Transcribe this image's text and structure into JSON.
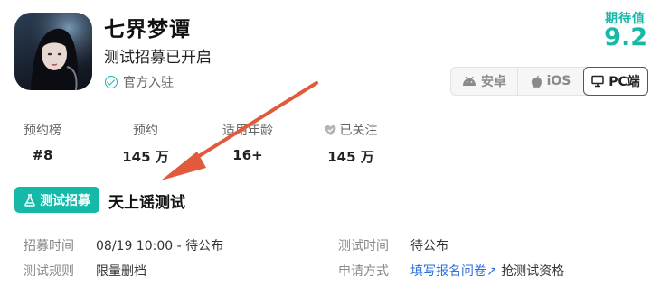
{
  "game": {
    "title": "七界梦谭",
    "subtitle": "测试招募已开启",
    "official_label": "官方入驻"
  },
  "rating": {
    "label": "期待值",
    "value": "9.2"
  },
  "platforms": {
    "android": "安卓",
    "ios": "iOS",
    "pc": "PC端",
    "selected": "PC端"
  },
  "stats": [
    {
      "label": "预约榜",
      "value": "#8"
    },
    {
      "label": "预约",
      "value": "145 万"
    },
    {
      "label": "适用年龄",
      "value": "16+"
    },
    {
      "label": "已关注",
      "value": "145 万"
    }
  ],
  "test": {
    "badge": "测试招募",
    "name": "天上谣测试",
    "recruit_time_label": "招募时间",
    "recruit_time_value": "08/19 10:00 - 待公布",
    "test_time_label": "测试时间",
    "test_time_value": "待公布",
    "rule_label": "测试规则",
    "rule_value": "限量删档",
    "apply_label": "申请方式",
    "apply_link": "填写报名问卷",
    "apply_suffix": "抢测试资格"
  },
  "colors": {
    "accent": "#14b9a8",
    "link": "#2b6fd6",
    "arrow": "#e15a3c"
  }
}
